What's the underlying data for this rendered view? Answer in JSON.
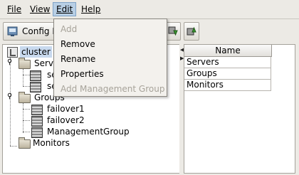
{
  "menu": {
    "file_label": "File",
    "view_label": "View",
    "edit_label": "Edit",
    "help_label": "Help"
  },
  "toolbar": {
    "config_label": "Config M"
  },
  "edit_menu": {
    "add": "Add",
    "remove": "Remove",
    "rename": "Rename",
    "properties": "Properties",
    "add_management_group": "Add Management Group"
  },
  "tree": {
    "root": "cluster",
    "servers": "Serve",
    "server1": "se",
    "server2": "se",
    "groups": "Groups",
    "failover1": "failover1",
    "failover2": "failover2",
    "management_group": "ManagementGroup",
    "monitors": "Monitors"
  },
  "table": {
    "header": "Name",
    "rows": [
      "Servers",
      "Groups",
      "Monitors"
    ]
  }
}
